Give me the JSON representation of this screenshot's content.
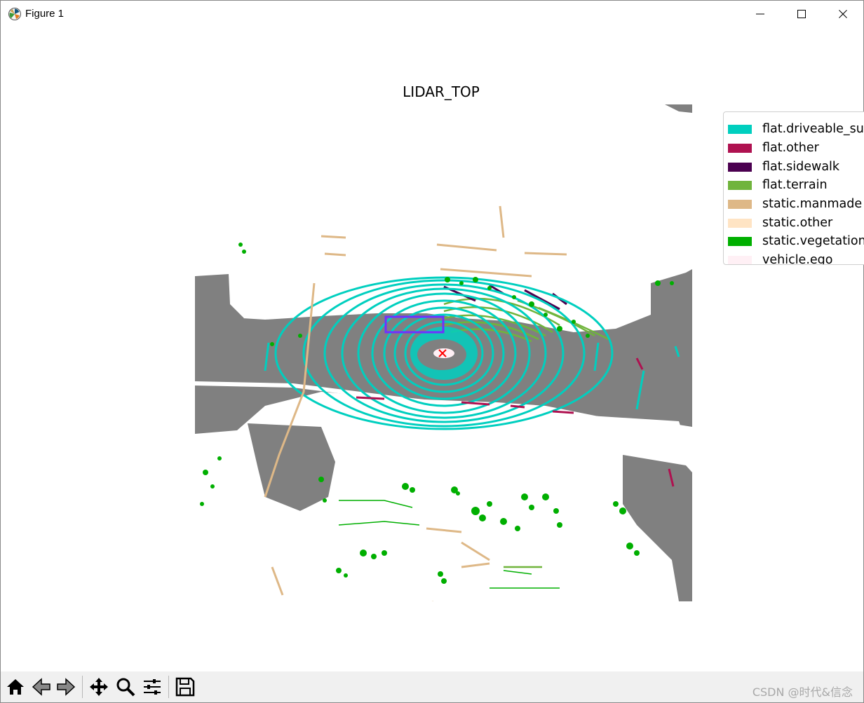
{
  "window": {
    "title": "Figure 1",
    "icon": "matplotlib-icon",
    "controls": [
      "minimize-icon",
      "maximize-icon",
      "close-icon"
    ]
  },
  "figure": {
    "title": "LIDAR_TOP",
    "legend": [
      {
        "label": "flat.driveable_su",
        "color": "#00cfbf"
      },
      {
        "label": "flat.other",
        "color": "#af1150"
      },
      {
        "label": "flat.sidewalk",
        "color": "#4b0050"
      },
      {
        "label": "flat.terrain",
        "color": "#70b43c"
      },
      {
        "label": "static.manmade",
        "color": "#deb887"
      },
      {
        "label": "static.other",
        "color": "#ffe4c4"
      },
      {
        "label": "static.vegetation",
        "color": "#00af00"
      },
      {
        "label": "vehicle.ego",
        "color": "#fff0f5"
      }
    ]
  },
  "toolbar": {
    "buttons": [
      "home-icon",
      "back-icon",
      "forward-icon",
      "pan-icon",
      "zoom-icon",
      "configure-subplots-icon",
      "save-icon"
    ],
    "watermark": "CSDN @时代&信念"
  }
}
